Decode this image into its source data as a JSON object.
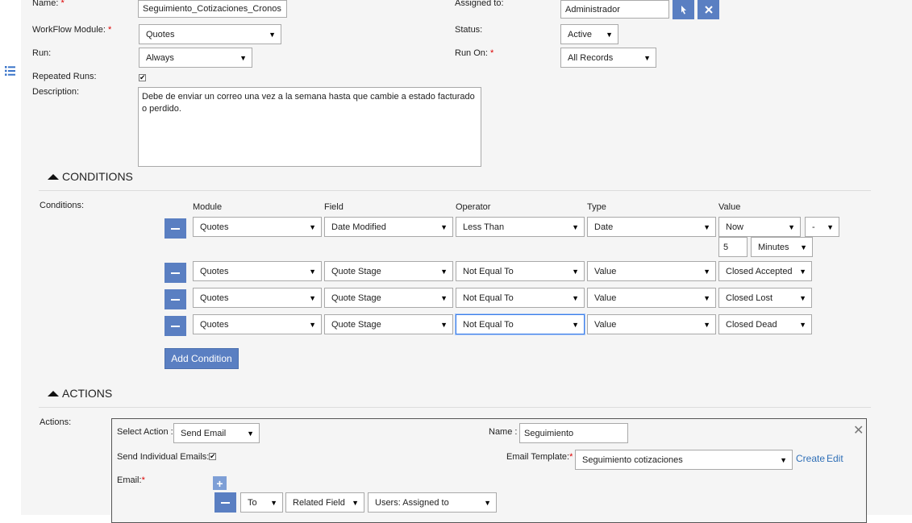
{
  "form": {
    "name_label": "Name:",
    "name_value": "Seguimiento_Cotizaciones_Cronos",
    "assigned_label": "Assigned to:",
    "assigned_value": "Administrador",
    "module_label": "WorkFlow Module:",
    "module_value": "Quotes",
    "status_label": "Status:",
    "status_value": "Active",
    "run_label": "Run:",
    "run_value": "Always",
    "runon_label": "Run On:",
    "runon_value": "All Records",
    "repeated_label": "Repeated Runs:",
    "repeated_checked": true,
    "description_label": "Description:",
    "description_value": "Debe de enviar un correo una vez a la semana hasta que cambie a estado facturado o perdido.",
    "required_mark": "*"
  },
  "conditions": {
    "section_title": "CONDITIONS",
    "label": "Conditions:",
    "headers": {
      "module": "Module",
      "field": "Field",
      "operator": "Operator",
      "type": "Type",
      "value": "Value"
    },
    "rows": [
      {
        "module": "Quotes",
        "field": "Date Modified",
        "operator": "Less Than",
        "type": "Date",
        "value": "Now",
        "extra": "-",
        "amount": "5",
        "unit": "Minutes"
      },
      {
        "module": "Quotes",
        "field": "Quote Stage",
        "operator": "Not Equal To",
        "type": "Value",
        "value": "Closed Accepted"
      },
      {
        "module": "Quotes",
        "field": "Quote Stage",
        "operator": "Not Equal To",
        "type": "Value",
        "value": "Closed Lost"
      },
      {
        "module": "Quotes",
        "field": "Quote Stage",
        "operator": "Not Equal To",
        "type": "Value",
        "value": "Closed Dead"
      }
    ],
    "add_button": "Add Condition"
  },
  "actions": {
    "section_title": "ACTIONS",
    "label": "Actions:",
    "select_action_label": "Select Action :",
    "select_action_value": "Send Email",
    "name_label": "Name :",
    "name_value": "Seguimiento",
    "individual_label": "Send Individual Emails:",
    "individual_checked": true,
    "template_label": "Email Template:",
    "template_value": "Seguimiento cotizaciones",
    "create_link": "Create",
    "edit_link": "Edit",
    "email_label": "Email:",
    "email_row": {
      "to": "To",
      "type": "Related Field",
      "field": "Users: Assigned to"
    }
  },
  "icons": {
    "select_arrow": "▼",
    "checkmark": "✔",
    "close": "✕",
    "plus": "+"
  }
}
